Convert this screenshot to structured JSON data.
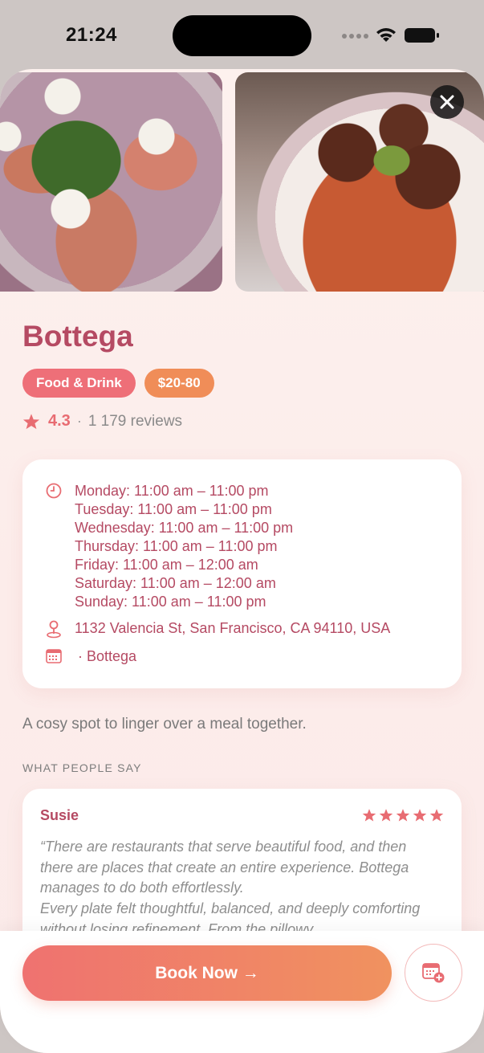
{
  "status_bar": {
    "time": "21:24"
  },
  "header": {
    "close_icon": "close-icon"
  },
  "place": {
    "name": "Bottega",
    "tags": [
      "Food & Drink",
      "$20-80"
    ],
    "rating": "4.3",
    "separator": "·",
    "review_count": "1 179 reviews"
  },
  "info": {
    "hours": [
      "Monday: 11:00 am – 11:00 pm",
      "Tuesday: 11:00 am – 11:00 pm",
      "Wednesday: 11:00 am – 11:00 pm",
      "Thursday: 11:00 am – 11:00 pm",
      "Friday: 11:00 am – 12:00 am",
      "Saturday: 11:00 am – 12:00 am",
      "Sunday: 11:00 am – 11:00 pm"
    ],
    "address": "1132 Valencia St, San Francisco, CA 94110, USA",
    "calendar": "· Bottega"
  },
  "description": "A cosy spot to linger over a meal together.",
  "reviews": {
    "section_title": "WHAT PEOPLE SAY",
    "items": [
      {
        "author": "Susie",
        "stars": 5,
        "text": "“There are restaurants that serve beautiful food, and then there are places that create an entire experience. Bottega manages to do both effortlessly.\nEvery plate felt thoughtful, balanced, and deeply comforting without losing refinement. From the pillowy"
      }
    ]
  },
  "actions": {
    "book_label": "Book Now →"
  },
  "colors": {
    "accent": "#b54a63",
    "coral": "#ee6f78",
    "orange": "#f08d58",
    "star": "#e86c72"
  }
}
